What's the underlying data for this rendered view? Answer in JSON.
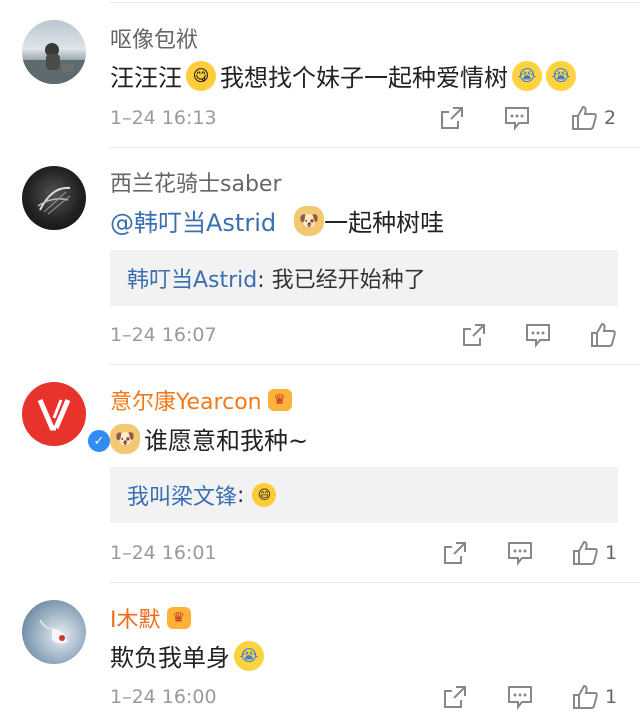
{
  "comments": [
    {
      "username": "呕像包袱",
      "text_main": "汪汪汪",
      "text_after_emoji": "我想找个妹子一起种爱情树",
      "time": "1–24 16:13",
      "like_count": "2"
    },
    {
      "username": "西兰花骑士saber",
      "mention": "@韩叮当Astrid",
      "text_after_emoji": "一起种树哇",
      "quote_name": "韩叮当Astrid",
      "quote_text": ": 我已经开始种了",
      "time": "1–24 16:07"
    },
    {
      "username": "意尔康Yearcon",
      "text_after_emoji": "谁愿意和我种~",
      "quote_name": "我叫梁文锋",
      "quote_text": ":",
      "time": "1–24 16:01",
      "like_count": "1"
    },
    {
      "username": "I木默",
      "text_main": "欺负我单身",
      "time": "1–24 16:00",
      "like_count": "1"
    }
  ],
  "icons": {
    "share": "share-icon",
    "comment": "comment-icon",
    "like": "thumbs-up-icon",
    "crown": "crown-badge-icon",
    "verified": "verified-badge-icon"
  },
  "colors": {
    "mention": "#3a6fb0",
    "vip_name": "#f07a1a",
    "meta": "#9a9a9a"
  }
}
